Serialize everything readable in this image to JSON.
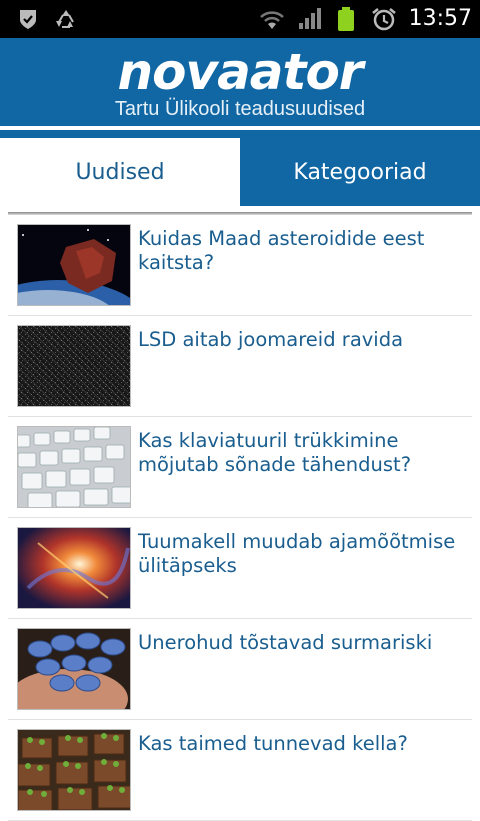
{
  "status_bar": {
    "time": "13:57",
    "icons": [
      "check-shield-icon",
      "recycle-icon",
      "wifi-icon",
      "signal-icon",
      "battery-icon",
      "alarm-icon"
    ]
  },
  "header": {
    "logo": "novaator",
    "subtitle": "Tartu Ülikooli teadusuudised"
  },
  "tabs": [
    {
      "label": "Uudised",
      "active": true
    },
    {
      "label": "Kategooriad",
      "active": false
    }
  ],
  "articles": [
    {
      "title": "Kuidas Maad asteroidide eest kaitsta?",
      "thumb": "asteroid-earth-image"
    },
    {
      "title": "LSD aitab joomareid ravida",
      "thumb": "noise-pattern-image"
    },
    {
      "title": "Kas klaviatuuril trükkimine mõjutab sõnade tähendust?",
      "thumb": "keyboard-image"
    },
    {
      "title": "Tuumakell muudab ajamõõtmise ülitäpseks",
      "thumb": "nebula-image"
    },
    {
      "title": "Unerohud tõstavad surmariski",
      "thumb": "pills-image"
    },
    {
      "title": "Kas taimed tunnevad kella?",
      "thumb": "plants-image"
    }
  ],
  "colors": {
    "brand_blue": "#1167a4",
    "title_blue": "#1a5e8f"
  }
}
